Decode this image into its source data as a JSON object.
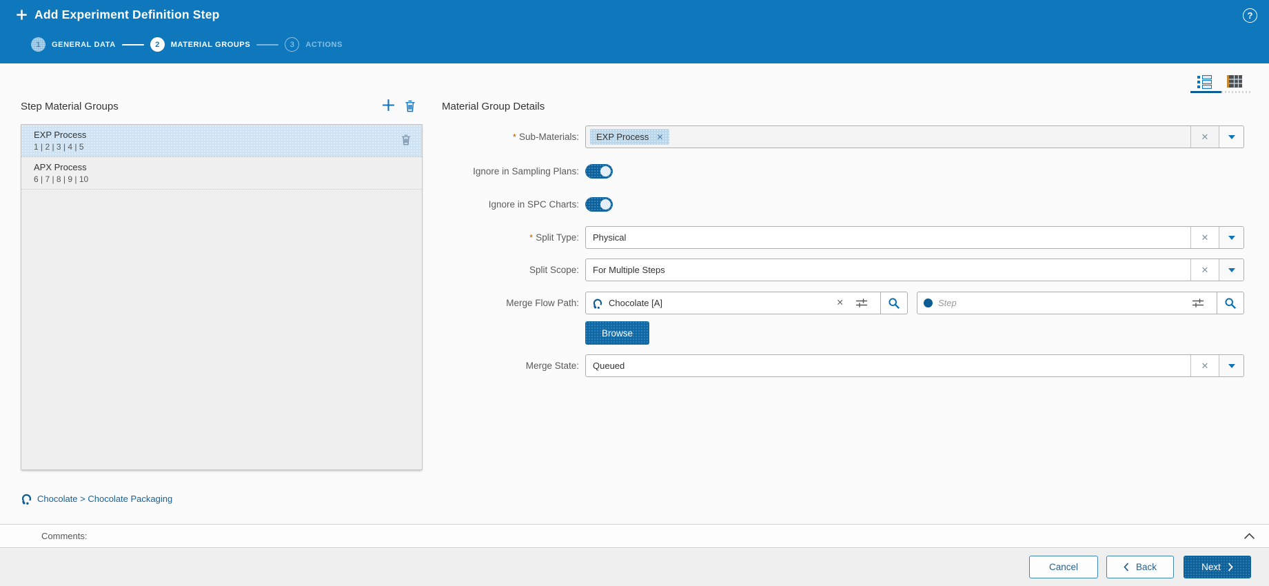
{
  "header": {
    "title": "Add Experiment Definition Step",
    "steps": [
      {
        "num": "1",
        "label": "GENERAL DATA",
        "state": "done"
      },
      {
        "num": "2",
        "label": "MATERIAL GROUPS",
        "state": "active"
      },
      {
        "num": "3",
        "label": "ACTIONS",
        "state": "pending"
      }
    ],
    "help_glyph": "?"
  },
  "left_panel": {
    "title": "Step Material Groups",
    "items": [
      {
        "title": "EXP Process",
        "subtitle": "1 | 2 | 3 | 4 | 5",
        "selected": true
      },
      {
        "title": "APX Process",
        "subtitle": "6 | 7 | 8 | 9 | 10",
        "selected": false
      }
    ]
  },
  "details": {
    "title": "Material Group Details",
    "sub_materials": {
      "label": "Sub-Materials:",
      "required": true,
      "chip": "EXP Process"
    },
    "ignore_sampling": {
      "label": "Ignore in Sampling Plans:",
      "value": true
    },
    "ignore_spc": {
      "label": "Ignore in SPC Charts:",
      "value": true
    },
    "split_type": {
      "label": "Split Type:",
      "required": true,
      "value": "Physical"
    },
    "split_scope": {
      "label": "Split Scope:",
      "value": "For Multiple Steps"
    },
    "merge_flow_path": {
      "label": "Merge Flow Path:",
      "value": "Chocolate [A]",
      "step_placeholder": "Step"
    },
    "browse_label": "Browse",
    "merge_state": {
      "label": "Merge State:",
      "value": "Queued"
    }
  },
  "breadcrumb": {
    "text": "Chocolate > Chocolate Packaging"
  },
  "comments": {
    "label": "Comments:"
  },
  "footer": {
    "cancel": "Cancel",
    "back": "Back",
    "next": "Next"
  },
  "colors": {
    "header_blue": "#0f78bd",
    "primary_blue": "#0e69a6",
    "selected_item": "#cde3f3",
    "toggle_on": "#0d639e"
  }
}
